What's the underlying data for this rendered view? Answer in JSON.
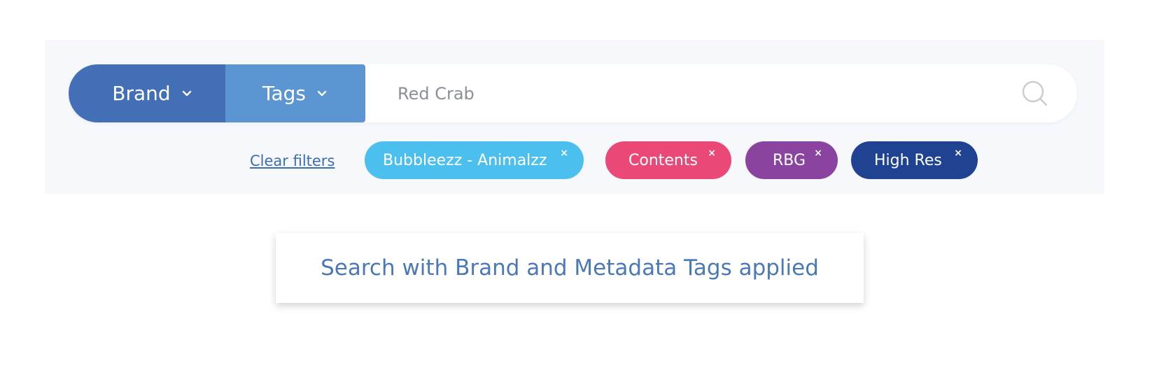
{
  "search": {
    "brand_label": "Brand",
    "tags_label": "Tags",
    "query_value": "Red Crab",
    "clear_filters_label": "Clear filters"
  },
  "chips": [
    {
      "label": "Bubbleezz - Animalzz",
      "remove": "×",
      "color": "#4bbfee"
    },
    {
      "label": "Contents",
      "remove": "×",
      "color": "#ea4876"
    },
    {
      "label": "RBG",
      "remove": "×",
      "color": "#8b43a0"
    },
    {
      "label": "High Res",
      "remove": "×",
      "color": "#1f4392"
    }
  ],
  "caption": {
    "text": "Search with Brand and Metadata Tags applied"
  },
  "colors": {
    "brand_button": "#436fb7",
    "tags_button": "#5b96d2",
    "panel_background": "#f7f8fc",
    "link": "#3d6fb0"
  },
  "icons": {
    "brand_dropdown": "chevron-down-icon",
    "tags_dropdown": "chevron-down-icon",
    "search": "search-icon",
    "chip_remove": "close-icon"
  }
}
